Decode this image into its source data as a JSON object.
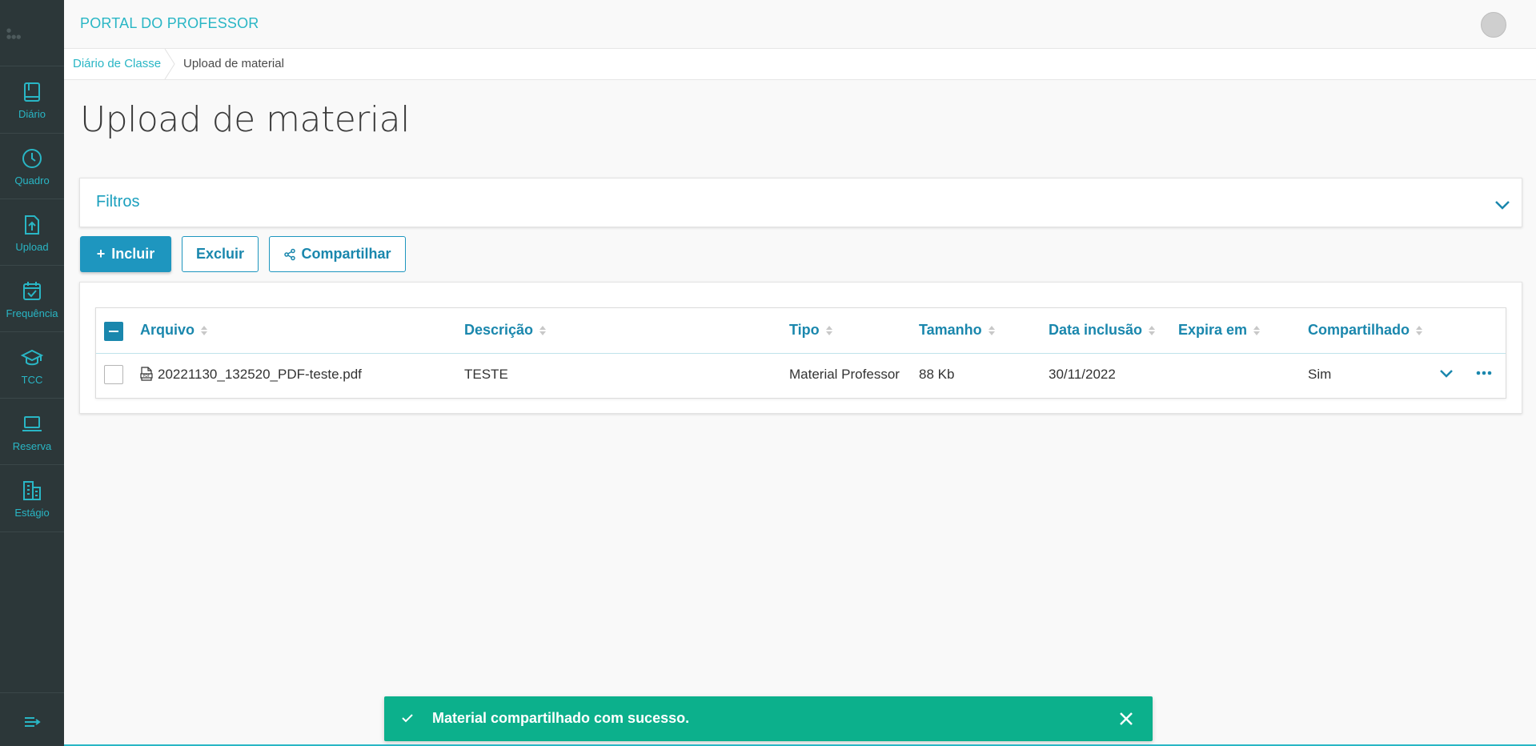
{
  "header": {
    "title": "PORTAL DO PROFESSOR"
  },
  "sidebar": {
    "items": [
      {
        "label": "Diário",
        "icon": "book-icon"
      },
      {
        "label": "Quadro",
        "icon": "clock-icon"
      },
      {
        "label": "Upload",
        "icon": "upload-file-icon"
      },
      {
        "label": "Frequência",
        "icon": "calendar-check-icon"
      },
      {
        "label": "TCC",
        "icon": "graduation-cap-icon"
      },
      {
        "label": "Reserva",
        "icon": "laptop-icon"
      },
      {
        "label": "Estágio",
        "icon": "building-icon"
      }
    ]
  },
  "breadcrumb": {
    "parent": "Diário de Classe",
    "current": "Upload de material"
  },
  "page": {
    "title": "Upload de material"
  },
  "filters": {
    "title": "Filtros"
  },
  "toolbar": {
    "include_label": "Incluir",
    "delete_label": "Excluir",
    "share_label": "Compartilhar"
  },
  "table": {
    "columns": [
      "Arquivo",
      "Descrição",
      "Tipo",
      "Tamanho",
      "Data inclusão",
      "Expira em",
      "Compartilhado"
    ],
    "rows": [
      {
        "arquivo": "20221130_132520_PDF-teste.pdf",
        "descricao": "TESTE",
        "tipo": "Material Professor",
        "tamanho": "88 Kb",
        "data_inclusao": "30/11/2022",
        "expira_em": "",
        "compartilhado": "Sim"
      }
    ]
  },
  "toast": {
    "message": "Material compartilhado com sucesso."
  },
  "colors": {
    "accent": "#29b6c5",
    "primary": "#1e96bf",
    "sidebar": "#2c3739",
    "success": "#0cb08c"
  }
}
